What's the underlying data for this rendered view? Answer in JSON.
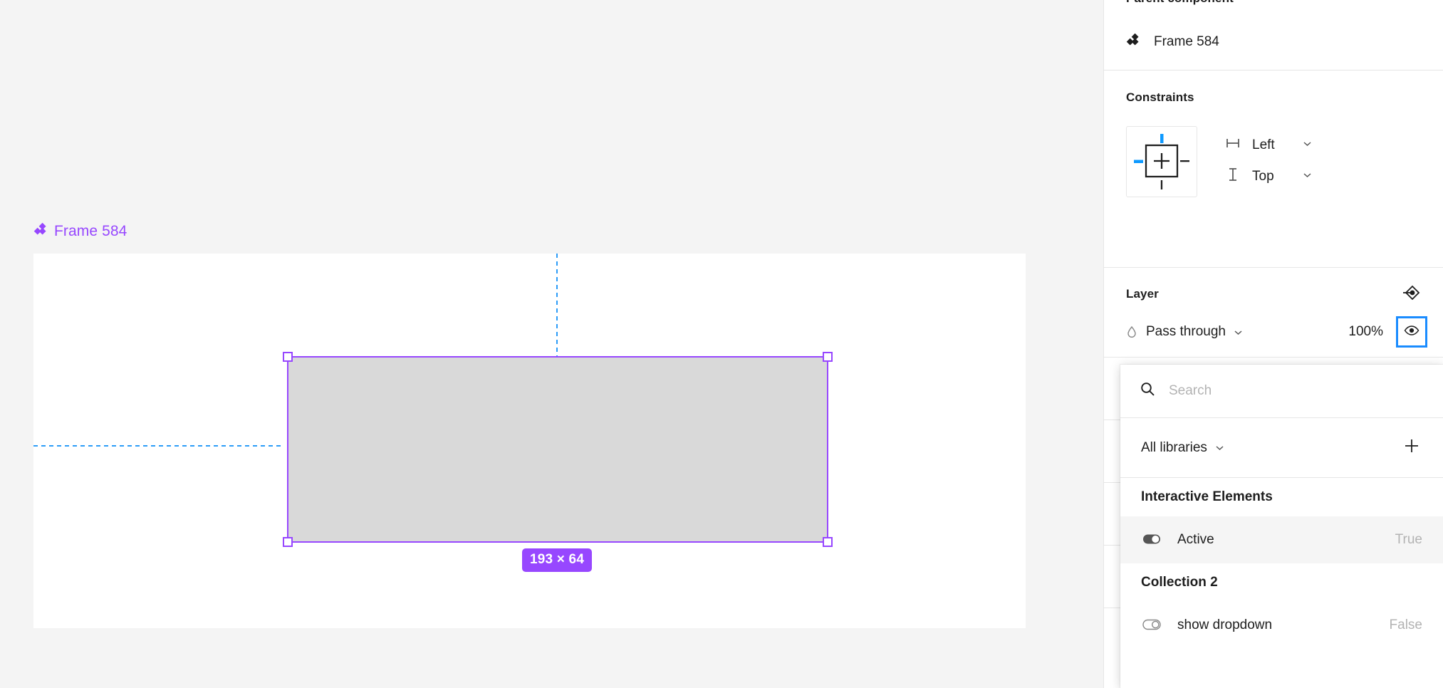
{
  "canvas": {
    "frame_label": "Frame 584",
    "frame_icon": "component-diamond-icon",
    "dimension_badge": "193 × 64",
    "selection_color": "#9747ff",
    "guide_color": "#2b9cf8",
    "rect_fill": "#d9d9d9",
    "background": "#f4f4f4"
  },
  "right_panel": {
    "parent_component": {
      "title": "Parent component",
      "item_label": "Frame 584",
      "item_icon": "component-diamond-icon"
    },
    "constraints": {
      "title": "Constraints",
      "widget_icon": "constraints-grid-icon",
      "horizontal": {
        "label": "Left",
        "icon": "horizontal-constraint-icon"
      },
      "vertical": {
        "label": "Top",
        "icon": "vertical-constraint-icon"
      }
    },
    "layer": {
      "title": "Layer",
      "apply_variable_icon": "apply-variable-icon",
      "blend_mode": "Pass through",
      "blend_icon": "blend-mode-drop-icon",
      "opacity": "100%",
      "visibility_icon": "eye-icon",
      "focus_color": "#1a8cff"
    }
  },
  "popup": {
    "search": {
      "placeholder": "Search",
      "value": "",
      "icon": "search-icon"
    },
    "libraries": {
      "label": "All libraries",
      "caret_icon": "chevron-down-icon",
      "add_icon": "plus-icon"
    },
    "groups": [
      {
        "name": "Interactive Elements",
        "variables": [
          {
            "name": "Active",
            "value": "True",
            "toggle": "on",
            "icon": "toggle-on-icon",
            "selected": true
          }
        ]
      },
      {
        "name": "Collection 2",
        "variables": [
          {
            "name": "show dropdown",
            "value": "False",
            "toggle": "off",
            "icon": "toggle-off-icon",
            "selected": false
          }
        ]
      }
    ]
  }
}
